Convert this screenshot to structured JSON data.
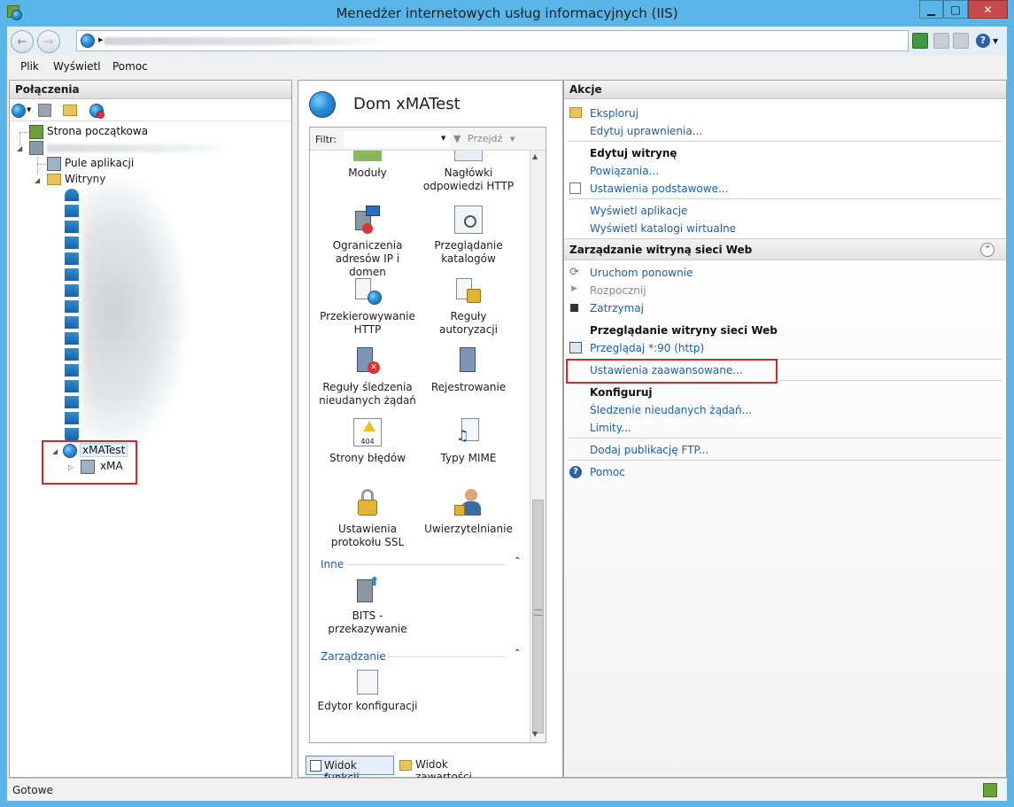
{
  "window": {
    "title": "Menedżer internetowych usług informacyjnych (IIS)",
    "controls": {
      "minimize": "▁",
      "maximize": "□",
      "close": "✕"
    }
  },
  "address": {
    "chevron": "▸",
    "help_label": "?"
  },
  "menu": [
    "Plik",
    "Wyświetl",
    "Pomoc"
  ],
  "connections": {
    "header": "Połączenia",
    "tree": {
      "start_page": "Strona początkowa",
      "app_pools": "Pule aplikacji",
      "sites": "Witryny",
      "selected_site": "xMATest",
      "child": "xMA"
    }
  },
  "center": {
    "title": "Dom xMATest",
    "filter_label": "Filtr:",
    "go_label": "Przejdź",
    "tiles": [
      [
        "Moduły",
        ""
      ],
      [
        "Nagłówki",
        "odpowiedzi HTTP"
      ],
      [
        "Ograniczenia",
        "adresów IP i domen"
      ],
      [
        "Przeglądanie",
        "katalogów"
      ],
      [
        "Przekierowywanie",
        "HTTP"
      ],
      [
        "Reguły autoryzacji",
        ""
      ],
      [
        "Reguły śledzenia",
        "nieudanych żądań"
      ],
      [
        "Rejestrowanie",
        ""
      ],
      [
        "Strony błędów",
        ""
      ],
      [
        "Typy MIME",
        ""
      ],
      [
        "Ustawienia",
        "protokołu SSL"
      ],
      [
        "Uwierzytelnianie",
        ""
      ]
    ],
    "error_icon_code": "404",
    "group_other": "Inne",
    "bits_tile": [
      "BITS -",
      "przekazywanie"
    ],
    "group_management": "Zarządzanie",
    "config_editor_tile": "Edytor konfiguracji",
    "view_features": "Widok funkcji",
    "view_content": "Widok zawartości"
  },
  "actions": {
    "header": "Akcje",
    "explore": "Eksploruj",
    "edit_permissions": "Edytuj uprawnienia...",
    "edit_site_head": "Edytuj witrynę",
    "bindings": "Powiązania...",
    "basic_settings": "Ustawienia podstawowe...",
    "view_apps": "Wyświetl aplikacje",
    "view_vdirs": "Wyświetl katalogi wirtualne",
    "manage_head": "Zarządzanie witryną sieci Web",
    "restart": "Uruchom ponownie",
    "start": "Rozpocznij",
    "stop": "Zatrzymaj",
    "browse_head": "Przeglądanie witryny sieci Web",
    "browse": "Przeglądaj *:90 (http)",
    "advanced_settings": "Ustawienia zaawansowane...",
    "configure_head": "Konfiguruj",
    "failed_request_tracing": "Śledzenie nieudanych żądań...",
    "limits": "Limity...",
    "add_ftp": "Dodaj publikację FTP...",
    "help": "Pomoc"
  },
  "status": {
    "text": "Gotowe"
  },
  "colors": {
    "link": "#1a5fb4",
    "highlight_box": "#d22a2a",
    "frame": "#5ab6e8"
  }
}
